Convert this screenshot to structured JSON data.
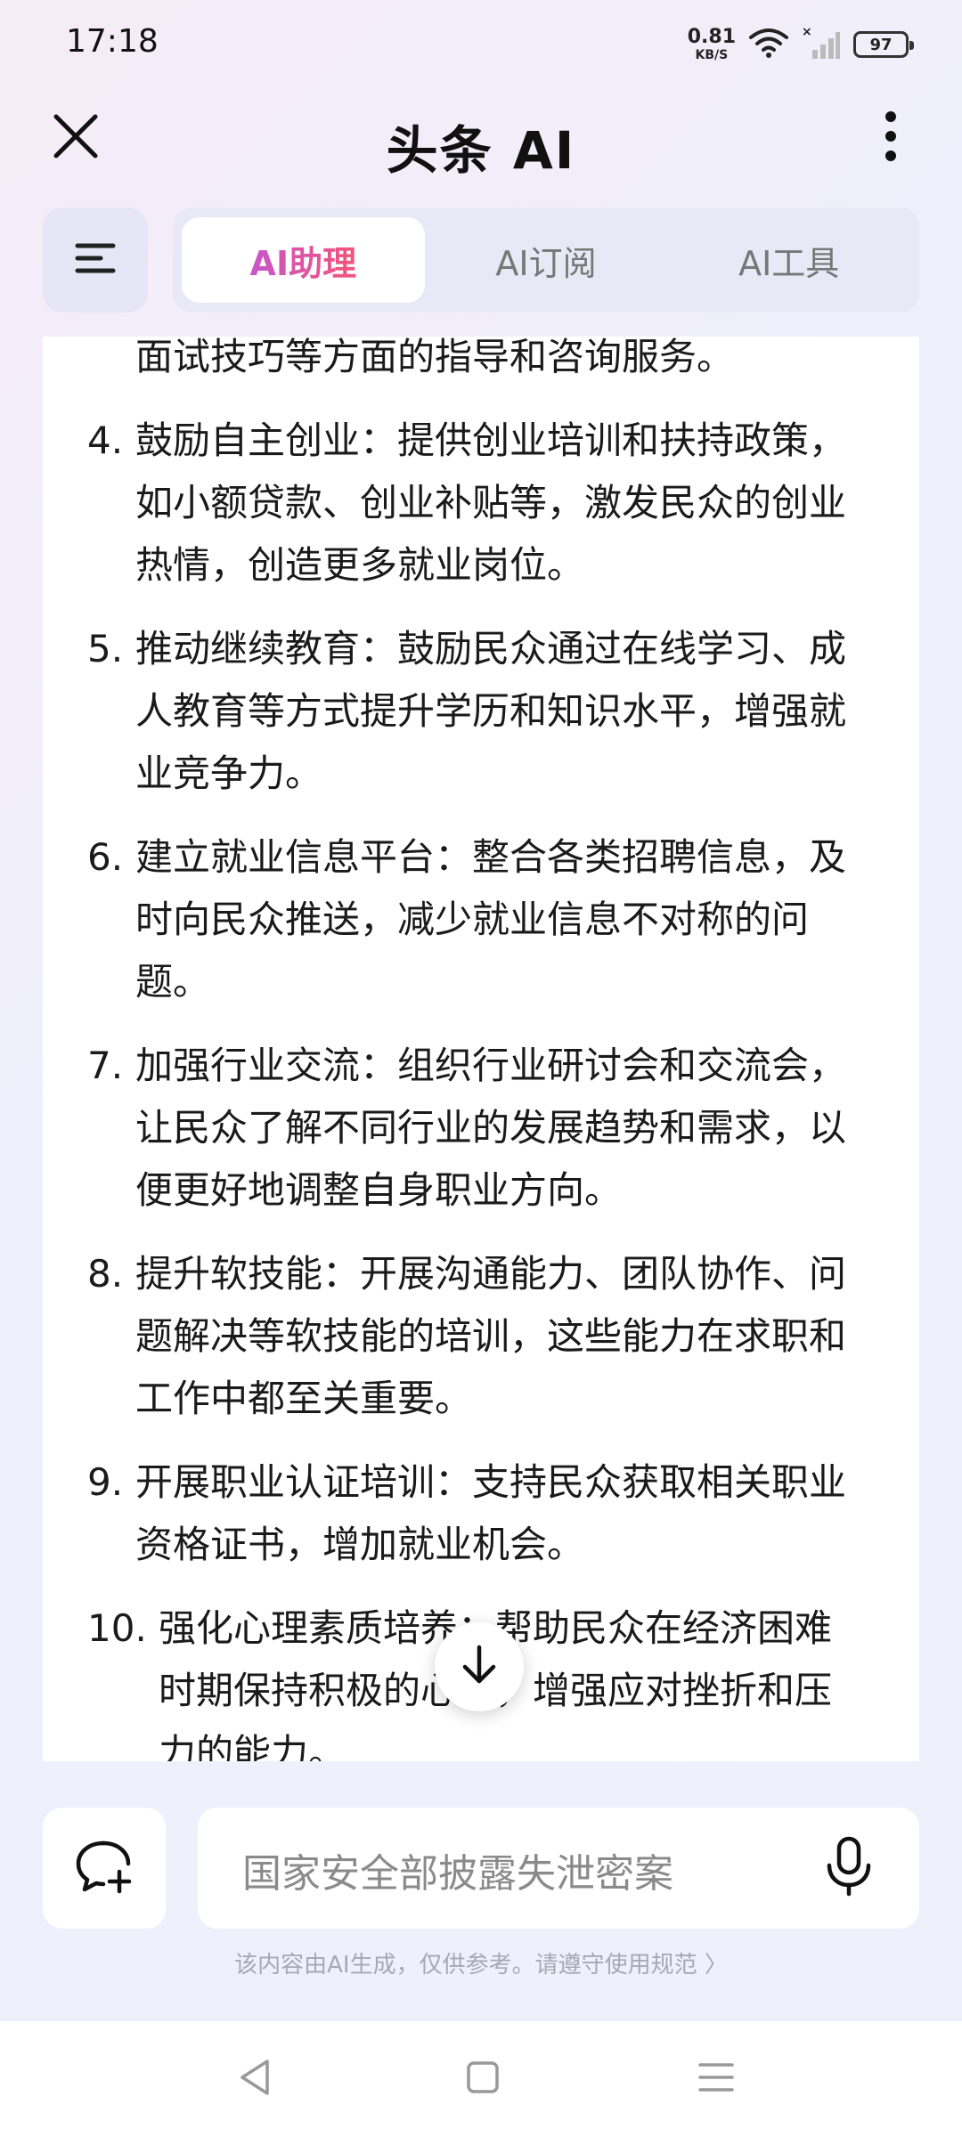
{
  "status_bar": {
    "time": "17:18",
    "net_speed_value": "0.81",
    "net_speed_unit": "KB/S",
    "battery": "97"
  },
  "header": {
    "title": "头条 AI"
  },
  "tabs": [
    {
      "label": "AI助理",
      "active": true
    },
    {
      "label": "AI订阅",
      "active": false
    },
    {
      "label": "AI工具",
      "active": false
    }
  ],
  "content": {
    "continuation": "面试技巧等方面的指导和咨询服务。",
    "items": [
      {
        "num": "4.",
        "text": "鼓励自主创业：提供创业培训和扶持政策，如小额贷款、创业补贴等，激发民众的创业热情，创造更多就业岗位。"
      },
      {
        "num": "5.",
        "text": "推动继续教育：鼓励民众通过在线学习、成人教育等方式提升学历和知识水平，增强就业竞争力。"
      },
      {
        "num": "6.",
        "text": "建立就业信息平台：整合各类招聘信息，及时向民众推送，减少就业信息不对称的问题。"
      },
      {
        "num": "7.",
        "text": "加强行业交流：组织行业研讨会和交流会，让民众了解不同行业的发展趋势和需求，以便更好地调整自身职业方向。"
      },
      {
        "num": "8.",
        "text": "提升软技能：开展沟通能力、团队协作、问题解决等软技能的培训，这些能力在求职和工作中都至关重要。"
      },
      {
        "num": "9.",
        "text": "开展职业认证培训：支持民众获取相关职业资格证书，增加就业机会。"
      },
      {
        "num": "10.",
        "text": "强化心理素质培养：帮助民众在经济困难时期保持积极的心态，增强应对挫折和压力的能力。"
      }
    ]
  },
  "input": {
    "placeholder": "国家安全部披露失泄密案"
  },
  "disclaimer": "该内容由AI生成，仅供参考。请遵守使用规范 〉",
  "icons": {
    "close": "close-icon",
    "more": "more-vertical-icon",
    "menu": "menu-icon",
    "scroll_down": "arrow-down-icon",
    "new_chat": "new-chat-icon",
    "mic": "mic-icon"
  }
}
